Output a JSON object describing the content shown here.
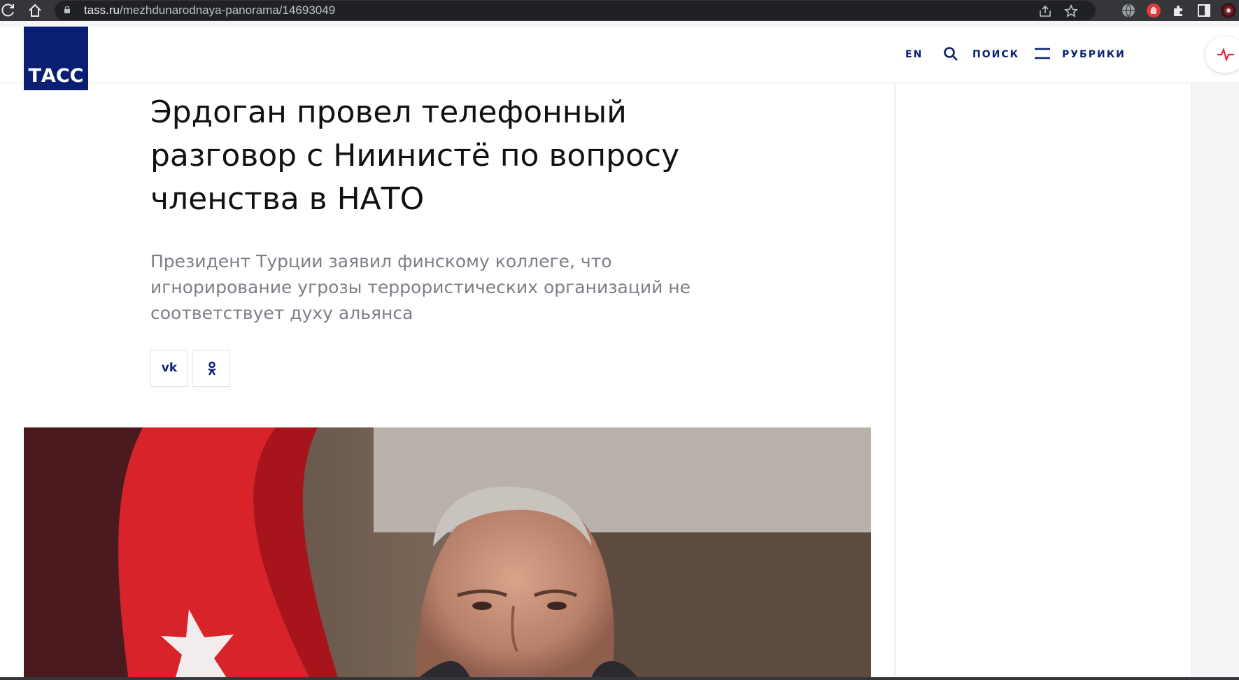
{
  "browser": {
    "url_host": "tass.ru",
    "url_path": "/mezhdunarodnaya-panorama/14693049"
  },
  "header": {
    "logo_text": "ТАСС",
    "lang_label": "EN",
    "search_label": "ПОИСК",
    "rubrics_label": "РУБРИКИ"
  },
  "article": {
    "title_line1": "Эрдоган провел телефонный",
    "title_line2": "разговор с Ниинистё по вопросу",
    "title_line3": "членства в НАТО",
    "lead_line1": "Президент Турции заявил финскому коллеге, что",
    "lead_line2": "игнорирование угрозы террористических организаций не",
    "lead_line3": "соответствует духу альянса"
  },
  "share": {
    "vk_label": "vk",
    "ok_icon": "odnoklassniki-icon"
  },
  "colors": {
    "brand_navy": "#0a1f72",
    "lead_gray": "#7c7f87",
    "pulse_red": "#e0243a"
  }
}
